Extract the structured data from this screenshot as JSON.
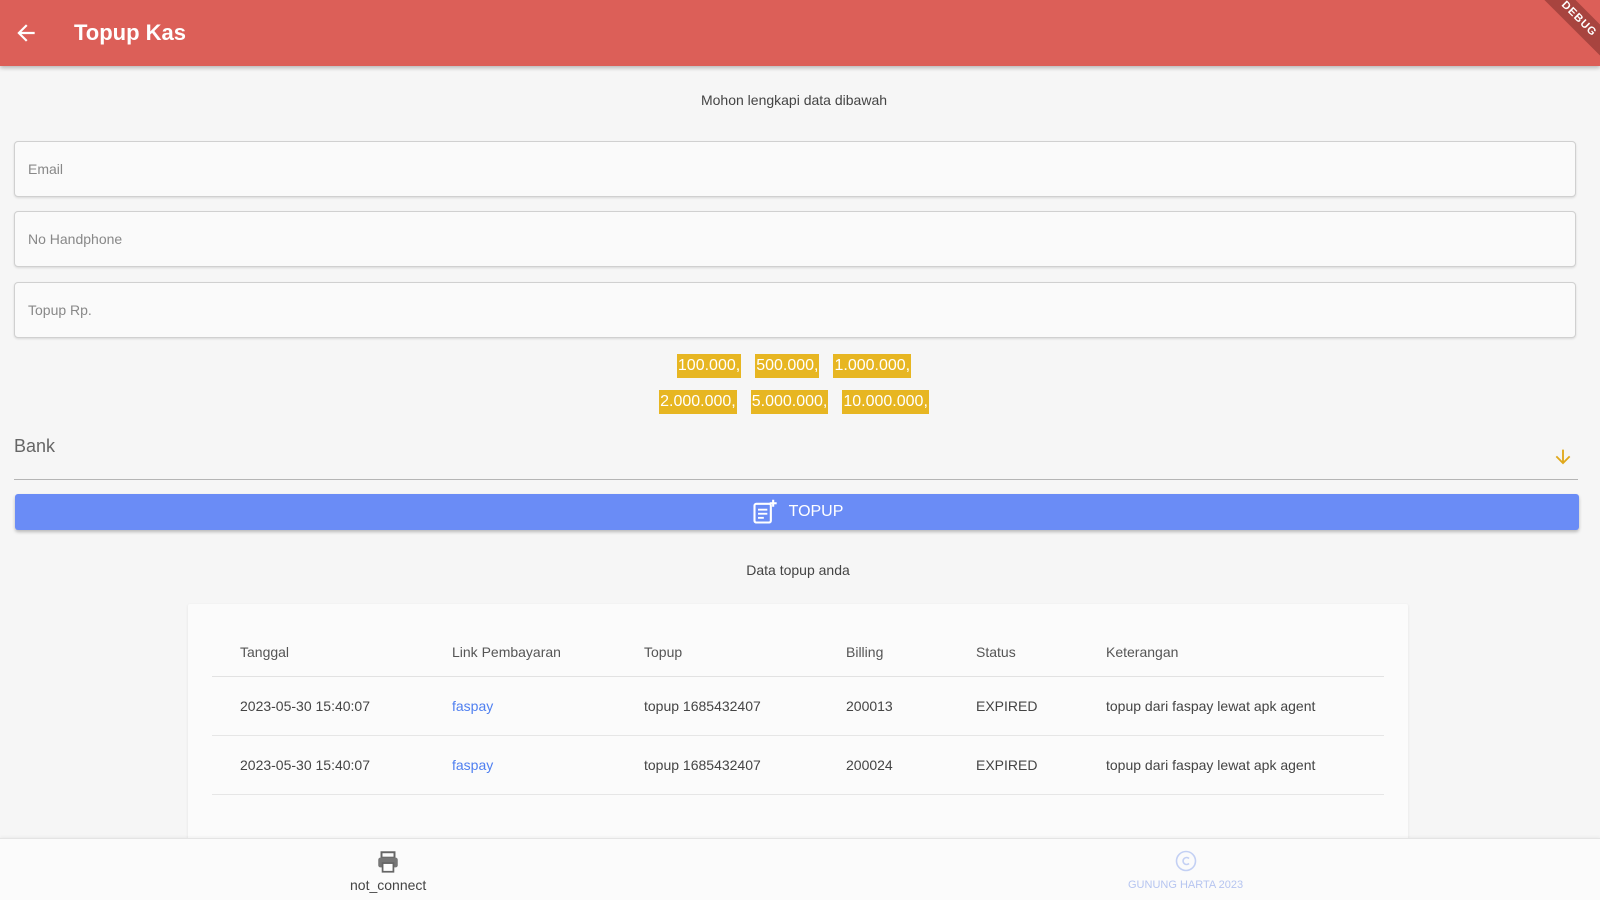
{
  "appbar": {
    "title": "Topup Kas",
    "back_icon": "arrow-left-icon",
    "ribbon": "DEBUG",
    "color": "#dc5f58"
  },
  "form": {
    "subtitle": "Mohon lengkapi data dibawah",
    "email_placeholder": "Email",
    "phone_placeholder": "No Handphone",
    "amount_placeholder": "Topup Rp.",
    "chips_row1": [
      "100.000,",
      "500.000,",
      "1.000.000,"
    ],
    "chips_row2": [
      "2.000.000,",
      "5.000.000,",
      "10.000.000,"
    ],
    "chip_color": "#e7b622",
    "bank_label": "Bank",
    "bank_icon": "arrow-down-icon",
    "topup_button": "TOPUP",
    "topup_icon": "note-add-icon",
    "button_color": "#6a8cf6"
  },
  "history": {
    "title": "Data topup anda",
    "columns": [
      "Tanggal",
      "Link Pembayaran",
      "Topup",
      "Billing",
      "Status",
      "Keterangan"
    ],
    "rows": [
      [
        "2023-05-30 15:40:07",
        "faspay",
        "topup 1685432407",
        "200013",
        "EXPIRED",
        "topup dari faspay lewat apk agent"
      ],
      [
        "2023-05-30 15:40:07",
        "faspay",
        "topup 1685432407",
        "200024",
        "EXPIRED",
        "topup dari faspay lewat apk agent"
      ]
    ]
  },
  "bottom_bar": {
    "printer_label": "not_connect",
    "printer_icon": "printer-icon",
    "copyright_label": "GUNUNG HARTA 2023",
    "copyright_icon": "copyright-icon"
  }
}
